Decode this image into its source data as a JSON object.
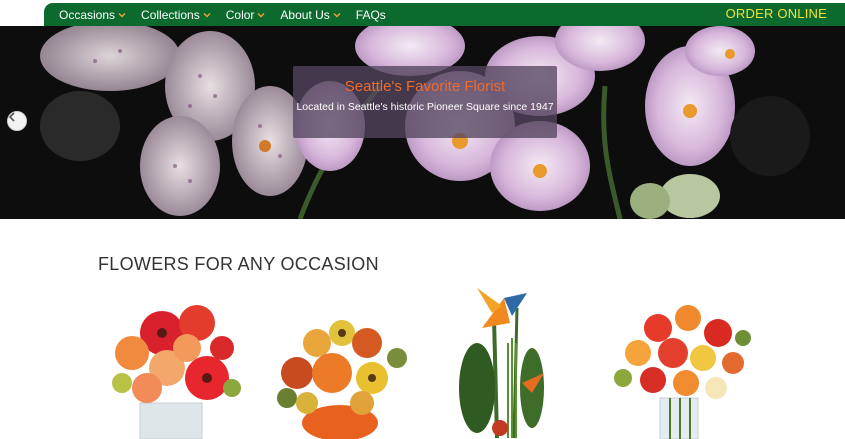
{
  "nav": {
    "items": [
      {
        "label": "Occasions",
        "has_dropdown": true
      },
      {
        "label": "Collections",
        "has_dropdown": true
      },
      {
        "label": "Color",
        "has_dropdown": true
      },
      {
        "label": "About Us",
        "has_dropdown": true
      },
      {
        "label": "FAQs",
        "has_dropdown": false
      }
    ],
    "cta": "ORDER ONLINE"
  },
  "hero": {
    "title": "Seattle's Favorite Florist",
    "subtitle": "Located in Seattle's historic Pioneer Square since 1947",
    "prev_icon": "chevron-left-icon"
  },
  "section": {
    "title": "FLOWERS FOR ANY OCCASION"
  },
  "colors": {
    "nav_bg": "#0c6a2e",
    "cta": "#f3e23a",
    "caption_title": "#f06a2b"
  }
}
